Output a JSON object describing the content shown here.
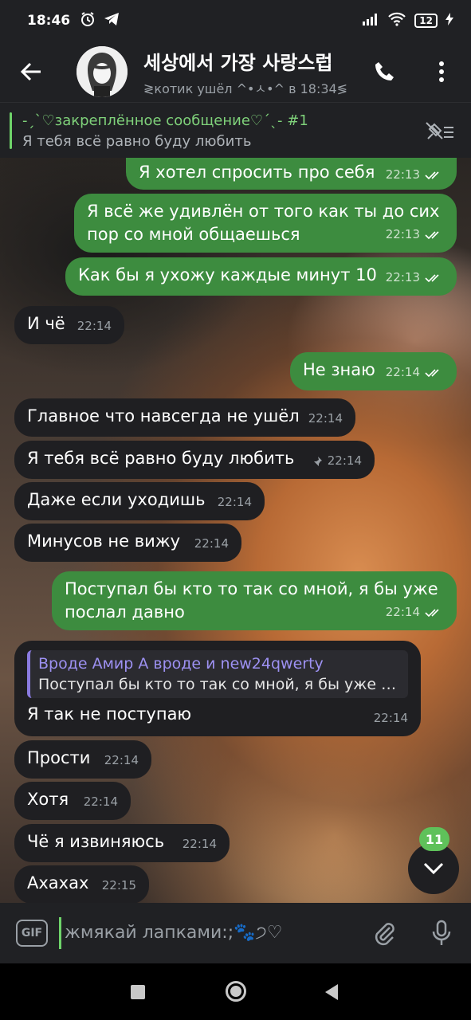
{
  "status_bar": {
    "time": "18:46",
    "battery": "12"
  },
  "header": {
    "title": "세상에서 가장 사랑스럽",
    "status": "≷котик ушёл ^•ㅅ•^ в 18:34≶"
  },
  "pinned": {
    "title": "-ˏˋ♡закреплённое сообщение♡ˊˎ- #1",
    "text": "Я тебя всё равно буду любить"
  },
  "messages": [
    {
      "direction": "out",
      "text": "Я хотел спросить про себя",
      "time": "22:13",
      "read": true
    },
    {
      "direction": "out",
      "text": "Я всё же удивлён от того как ты до сих пор со мной общаешься",
      "time": "22:13",
      "read": true
    },
    {
      "direction": "out",
      "text": "Как бы я ухожу каждые минут 10",
      "time": "22:13",
      "read": true
    },
    {
      "direction": "in",
      "text": "И чё",
      "time": "22:14"
    },
    {
      "direction": "out",
      "text": "Не знаю",
      "time": "22:14",
      "read": true
    },
    {
      "direction": "in",
      "text": "Главное что навсегда не ушёл",
      "time": "22:14"
    },
    {
      "direction": "in",
      "text": "Я тебя всё равно буду любить",
      "time": "22:14",
      "pinned": true
    },
    {
      "direction": "in",
      "text": "Даже если уходишь",
      "time": "22:14"
    },
    {
      "direction": "in",
      "text": "Минусов не вижу",
      "time": "22:14"
    },
    {
      "direction": "out",
      "text": "Поступал бы кто то так со мной, я бы уже послал давно",
      "time": "22:14",
      "read": true
    },
    {
      "direction": "in",
      "text": "Я так не поступаю",
      "time": "22:14",
      "reply": {
        "name": "Вроде Амир А вроде и new24qwerty",
        "text": "Поступал бы кто то так со мной, я бы уже послал давно"
      }
    },
    {
      "direction": "in",
      "text": "Прости",
      "time": "22:14"
    },
    {
      "direction": "in",
      "text": "Хотя",
      "time": "22:14"
    },
    {
      "direction": "in",
      "text": "Чё я извиняюсь",
      "time": "22:14"
    },
    {
      "direction": "in",
      "text": "Ахахах",
      "time": "22:15"
    }
  ],
  "unread_count": "11",
  "input": {
    "gif_label": "GIF",
    "placeholder": "жмякай лапками:;🐾੭♡"
  },
  "colors": {
    "outgoing_bubble": "#3d8c3f",
    "incoming_bubble": "#1f1f22",
    "accent_green": "#6fd46a",
    "reply_accent": "#8a7be0"
  }
}
